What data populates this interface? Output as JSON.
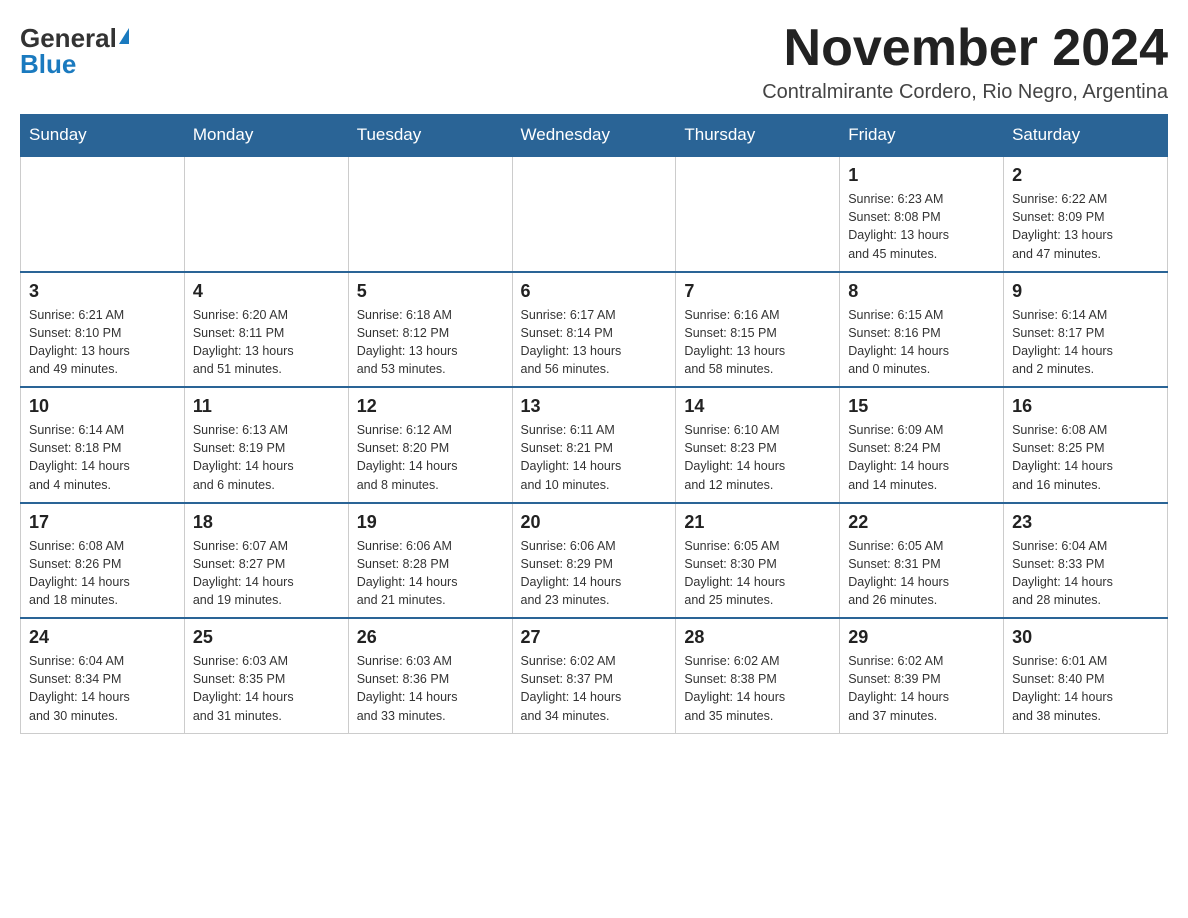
{
  "header": {
    "logo_general": "General",
    "logo_blue": "Blue",
    "month_title": "November 2024",
    "location": "Contralmirante Cordero, Rio Negro, Argentina"
  },
  "days_of_week": [
    "Sunday",
    "Monday",
    "Tuesday",
    "Wednesday",
    "Thursday",
    "Friday",
    "Saturday"
  ],
  "weeks": [
    [
      {
        "day": "",
        "info": ""
      },
      {
        "day": "",
        "info": ""
      },
      {
        "day": "",
        "info": ""
      },
      {
        "day": "",
        "info": ""
      },
      {
        "day": "",
        "info": ""
      },
      {
        "day": "1",
        "info": "Sunrise: 6:23 AM\nSunset: 8:08 PM\nDaylight: 13 hours\nand 45 minutes."
      },
      {
        "day": "2",
        "info": "Sunrise: 6:22 AM\nSunset: 8:09 PM\nDaylight: 13 hours\nand 47 minutes."
      }
    ],
    [
      {
        "day": "3",
        "info": "Sunrise: 6:21 AM\nSunset: 8:10 PM\nDaylight: 13 hours\nand 49 minutes."
      },
      {
        "day": "4",
        "info": "Sunrise: 6:20 AM\nSunset: 8:11 PM\nDaylight: 13 hours\nand 51 minutes."
      },
      {
        "day": "5",
        "info": "Sunrise: 6:18 AM\nSunset: 8:12 PM\nDaylight: 13 hours\nand 53 minutes."
      },
      {
        "day": "6",
        "info": "Sunrise: 6:17 AM\nSunset: 8:14 PM\nDaylight: 13 hours\nand 56 minutes."
      },
      {
        "day": "7",
        "info": "Sunrise: 6:16 AM\nSunset: 8:15 PM\nDaylight: 13 hours\nand 58 minutes."
      },
      {
        "day": "8",
        "info": "Sunrise: 6:15 AM\nSunset: 8:16 PM\nDaylight: 14 hours\nand 0 minutes."
      },
      {
        "day": "9",
        "info": "Sunrise: 6:14 AM\nSunset: 8:17 PM\nDaylight: 14 hours\nand 2 minutes."
      }
    ],
    [
      {
        "day": "10",
        "info": "Sunrise: 6:14 AM\nSunset: 8:18 PM\nDaylight: 14 hours\nand 4 minutes."
      },
      {
        "day": "11",
        "info": "Sunrise: 6:13 AM\nSunset: 8:19 PM\nDaylight: 14 hours\nand 6 minutes."
      },
      {
        "day": "12",
        "info": "Sunrise: 6:12 AM\nSunset: 8:20 PM\nDaylight: 14 hours\nand 8 minutes."
      },
      {
        "day": "13",
        "info": "Sunrise: 6:11 AM\nSunset: 8:21 PM\nDaylight: 14 hours\nand 10 minutes."
      },
      {
        "day": "14",
        "info": "Sunrise: 6:10 AM\nSunset: 8:23 PM\nDaylight: 14 hours\nand 12 minutes."
      },
      {
        "day": "15",
        "info": "Sunrise: 6:09 AM\nSunset: 8:24 PM\nDaylight: 14 hours\nand 14 minutes."
      },
      {
        "day": "16",
        "info": "Sunrise: 6:08 AM\nSunset: 8:25 PM\nDaylight: 14 hours\nand 16 minutes."
      }
    ],
    [
      {
        "day": "17",
        "info": "Sunrise: 6:08 AM\nSunset: 8:26 PM\nDaylight: 14 hours\nand 18 minutes."
      },
      {
        "day": "18",
        "info": "Sunrise: 6:07 AM\nSunset: 8:27 PM\nDaylight: 14 hours\nand 19 minutes."
      },
      {
        "day": "19",
        "info": "Sunrise: 6:06 AM\nSunset: 8:28 PM\nDaylight: 14 hours\nand 21 minutes."
      },
      {
        "day": "20",
        "info": "Sunrise: 6:06 AM\nSunset: 8:29 PM\nDaylight: 14 hours\nand 23 minutes."
      },
      {
        "day": "21",
        "info": "Sunrise: 6:05 AM\nSunset: 8:30 PM\nDaylight: 14 hours\nand 25 minutes."
      },
      {
        "day": "22",
        "info": "Sunrise: 6:05 AM\nSunset: 8:31 PM\nDaylight: 14 hours\nand 26 minutes."
      },
      {
        "day": "23",
        "info": "Sunrise: 6:04 AM\nSunset: 8:33 PM\nDaylight: 14 hours\nand 28 minutes."
      }
    ],
    [
      {
        "day": "24",
        "info": "Sunrise: 6:04 AM\nSunset: 8:34 PM\nDaylight: 14 hours\nand 30 minutes."
      },
      {
        "day": "25",
        "info": "Sunrise: 6:03 AM\nSunset: 8:35 PM\nDaylight: 14 hours\nand 31 minutes."
      },
      {
        "day": "26",
        "info": "Sunrise: 6:03 AM\nSunset: 8:36 PM\nDaylight: 14 hours\nand 33 minutes."
      },
      {
        "day": "27",
        "info": "Sunrise: 6:02 AM\nSunset: 8:37 PM\nDaylight: 14 hours\nand 34 minutes."
      },
      {
        "day": "28",
        "info": "Sunrise: 6:02 AM\nSunset: 8:38 PM\nDaylight: 14 hours\nand 35 minutes."
      },
      {
        "day": "29",
        "info": "Sunrise: 6:02 AM\nSunset: 8:39 PM\nDaylight: 14 hours\nand 37 minutes."
      },
      {
        "day": "30",
        "info": "Sunrise: 6:01 AM\nSunset: 8:40 PM\nDaylight: 14 hours\nand 38 minutes."
      }
    ]
  ]
}
